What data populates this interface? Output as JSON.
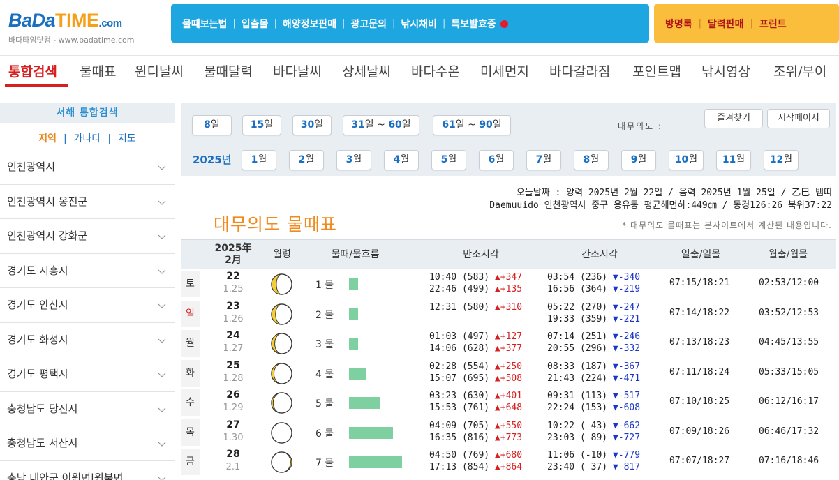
{
  "logo": {
    "text_bada": "BaDa",
    "text_time": "TIME",
    "text_com": ".com",
    "subtitle": "바다타임닷컴 - www.badatime.com"
  },
  "top_nav": [
    "물때보는법",
    "입출몰",
    "해양정보판매",
    "광고문의",
    "낚시채비",
    "특보발효중"
  ],
  "top_nav_right": [
    "방명록",
    "달력판매",
    "프린트"
  ],
  "main_menu": [
    "통합검색",
    "물때표",
    "윈디날씨",
    "물때달력",
    "바다날씨",
    "상세날씨",
    "바다수온",
    "미세먼지",
    "바다갈라짐",
    "포인트맵",
    "낚시영상",
    "조위/부이"
  ],
  "sidebar": {
    "title": "서해 통합검색",
    "tabs": [
      "지역",
      "가나다",
      "지도"
    ],
    "items": [
      "인천광역시",
      "인천광역시 옹진군",
      "인천광역시 강화군",
      "경기도 시흥시",
      "경기도 안산시",
      "경기도 화성시",
      "경기도 평택시",
      "충청남도 당진시",
      "충청남도 서산시",
      "충남 태안군 이원면|원북면"
    ]
  },
  "filters": {
    "range_buttons": [
      {
        "num": "8",
        "unit": "일"
      },
      {
        "num": "15",
        "unit": "일"
      },
      {
        "num": "30",
        "unit": "일"
      },
      {
        "num": "31",
        "unit": "일 ~ ",
        "num2": "60",
        "unit2": "일"
      },
      {
        "num": "61",
        "unit": "일 ~ ",
        "num2": "90",
        "unit2": "일"
      }
    ],
    "year": "2025년",
    "month_buttons": [
      {
        "num": "1",
        "unit": "월"
      },
      {
        "num": "2",
        "unit": "월"
      },
      {
        "num": "3",
        "unit": "월"
      },
      {
        "num": "4",
        "unit": "월"
      },
      {
        "num": "5",
        "unit": "월"
      },
      {
        "num": "6",
        "unit": "월"
      },
      {
        "num": "7",
        "unit": "월"
      },
      {
        "num": "8",
        "unit": "월"
      },
      {
        "num": "9",
        "unit": "월"
      },
      {
        "num": "10",
        "unit": "월"
      },
      {
        "num": "11",
        "unit": "월"
      },
      {
        "num": "12",
        "unit": "월"
      }
    ],
    "place_label": "대무의도 :",
    "bookmark_label": "즐겨찾기",
    "homepage_label": "시작페이지"
  },
  "info": {
    "line1": "오늘날짜 : 양력 2025년 2월 22일 / 음력 2025년 1월 25일 / 乙巳 뱀띠",
    "line2": "Daemuuido 인천광역시 중구 용유동 평균해면하:449㎝ / 동경126:26 북위37:22"
  },
  "page_title": "대무의도 물때표",
  "note": "* 대무의도 물때표는 본사이트에서 계산된 내용입니다.",
  "table": {
    "headers": {
      "date_year": "2025年",
      "date_month": "2月",
      "moon_age": "월령",
      "tide": "물때/물흐름",
      "high": "만조시각",
      "low": "간조시각",
      "sunrise": "일출/일몰",
      "moonrise": "월출/월몰"
    },
    "rows": [
      {
        "dow": "토",
        "day": "22",
        "lunar": "1.25",
        "mul": "1 물",
        "flow": 0.17,
        "moon_phase": 0.88,
        "high1": "10:40 (583)",
        "high1_d": "+347",
        "high2": "22:46 (499)",
        "high2_d": "+135",
        "low1": "03:54 (236)",
        "low1_d": "-340",
        "low2": "16:56 (364)",
        "low2_d": "-219",
        "sun": "07:15/18:21",
        "moon": "02:53/12:00"
      },
      {
        "dow": "일",
        "day": "23",
        "lunar": "1.26",
        "mul": "2 물",
        "flow": 0.17,
        "moon_phase": 0.9,
        "high1": "12:31 (580)",
        "high1_d": "+310",
        "high2": "",
        "high2_d": "",
        "low1": "05:22 (270)",
        "low1_d": "-247",
        "low2": "19:33 (359)",
        "low2_d": "-221",
        "sun": "07:14/18:22",
        "moon": "03:52/12:53"
      },
      {
        "dow": "월",
        "day": "24",
        "lunar": "1.27",
        "mul": "3 물",
        "flow": 0.17,
        "moon_phase": 0.92,
        "high1": "01:03 (497)",
        "high1_d": "+127",
        "high2": "14:06 (628)",
        "high2_d": "+377",
        "low1": "07:14 (251)",
        "low1_d": "-246",
        "low2": "20:55 (296)",
        "low2_d": "-332",
        "sun": "07:13/18:23",
        "moon": "04:45/13:55"
      },
      {
        "dow": "화",
        "day": "25",
        "lunar": "1.28",
        "mul": "4 물",
        "flow": 0.33,
        "moon_phase": 0.94,
        "high1": "02:28 (554)",
        "high1_d": "+250",
        "high2": "15:07 (695)",
        "high2_d": "+508",
        "low1": "08:33 (187)",
        "low1_d": "-367",
        "low2": "21:43 (224)",
        "low2_d": "-471",
        "sun": "07:11/18:24",
        "moon": "05:33/15:05"
      },
      {
        "dow": "수",
        "day": "26",
        "lunar": "1.29",
        "mul": "5 물",
        "flow": 0.58,
        "moon_phase": 0.96,
        "high1": "03:23 (630)",
        "high1_d": "+401",
        "high2": "15:53 (761)",
        "high2_d": "+648",
        "low1": "09:31 (113)",
        "low1_d": "-517",
        "low2": "22:24 (153)",
        "low2_d": "-608",
        "sun": "07:10/18:25",
        "moon": "06:12/16:17"
      },
      {
        "dow": "목",
        "day": "27",
        "lunar": "1.30",
        "mul": "6 물",
        "flow": 0.83,
        "moon_phase": 1.0,
        "high1": "04:09 (705)",
        "high1_d": "+550",
        "high2": "16:35 (816)",
        "high2_d": "+773",
        "low1": "10:22 ( 43)",
        "low1_d": "-662",
        "low2": "23:03 ( 89)",
        "low2_d": "-727",
        "sun": "07:09/18:26",
        "moon": "06:46/17:32"
      },
      {
        "dow": "금",
        "day": "28",
        "lunar": "2.1",
        "mul": "7 물",
        "flow": 1.0,
        "moon_phase": 0.03,
        "high1": "04:50 (769)",
        "high1_d": "+680",
        "high2": "17:13 (854)",
        "high2_d": "+864",
        "low1": "11:06 (-10)",
        "low1_d": "-779",
        "low2": "23:40 ( 37)",
        "low2_d": "-817",
        "sun": "07:07/18:27",
        "moon": "07:16/18:46"
      }
    ]
  },
  "colors": {
    "accent_blue": "#1ea6e0",
    "accent_orange": "#fbbd3c",
    "active_red": "#d61f1f",
    "tide_bar": "#7fd0a0"
  }
}
